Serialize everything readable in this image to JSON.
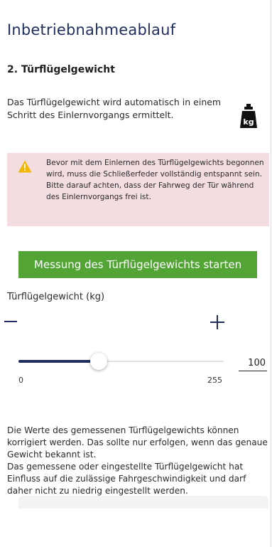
{
  "page": {
    "title": "Inbetriebnahmeablauf",
    "section_title": "2. Türflügelgewicht",
    "intro_text": "Das Türflügelgewicht wird automatisch in einem Schritt des Einlernvorgangs ermittelt.",
    "kg_icon": "kg-weight-icon",
    "kg_icon_label": "kg"
  },
  "warning": {
    "icon": "warning-icon",
    "line1": "Bevor mit dem Einlernen des Türflügelgewichts begonnen wird, muss die Schließerfeder vollständig entspannt sein.",
    "line2": "Bitte darauf achten, dass der Fahrweg der Tür während des Einlernvorgangs frei ist.",
    "background": "#f4dde1",
    "accent": "#f2b705"
  },
  "start_button": {
    "label": "Messung des Türflügelgewichts starten",
    "color": "#52a534"
  },
  "weight": {
    "label": "Türflügelgewicht (kg)",
    "minus_icon": "minus-icon",
    "plus_icon": "plus-icon",
    "value": "100",
    "slider_min": "0",
    "slider_max": "255",
    "slider_value": 100
  },
  "info": {
    "paragraph1": "Die Werte des gemessenen Türflügelgewichts können korrigiert werden. Das sollte nur erfolgen, wenn das genaue Gewicht bekannt ist.",
    "paragraph2": "Das gemessene oder eingestellte Türflügelgewicht hat Einfluss auf die zulässige Fahrgeschwindigkeit und darf daher nicht zu niedrig eingestellt werden."
  },
  "colors": {
    "brand": "#1e2d5e",
    "green": "#52a534"
  }
}
